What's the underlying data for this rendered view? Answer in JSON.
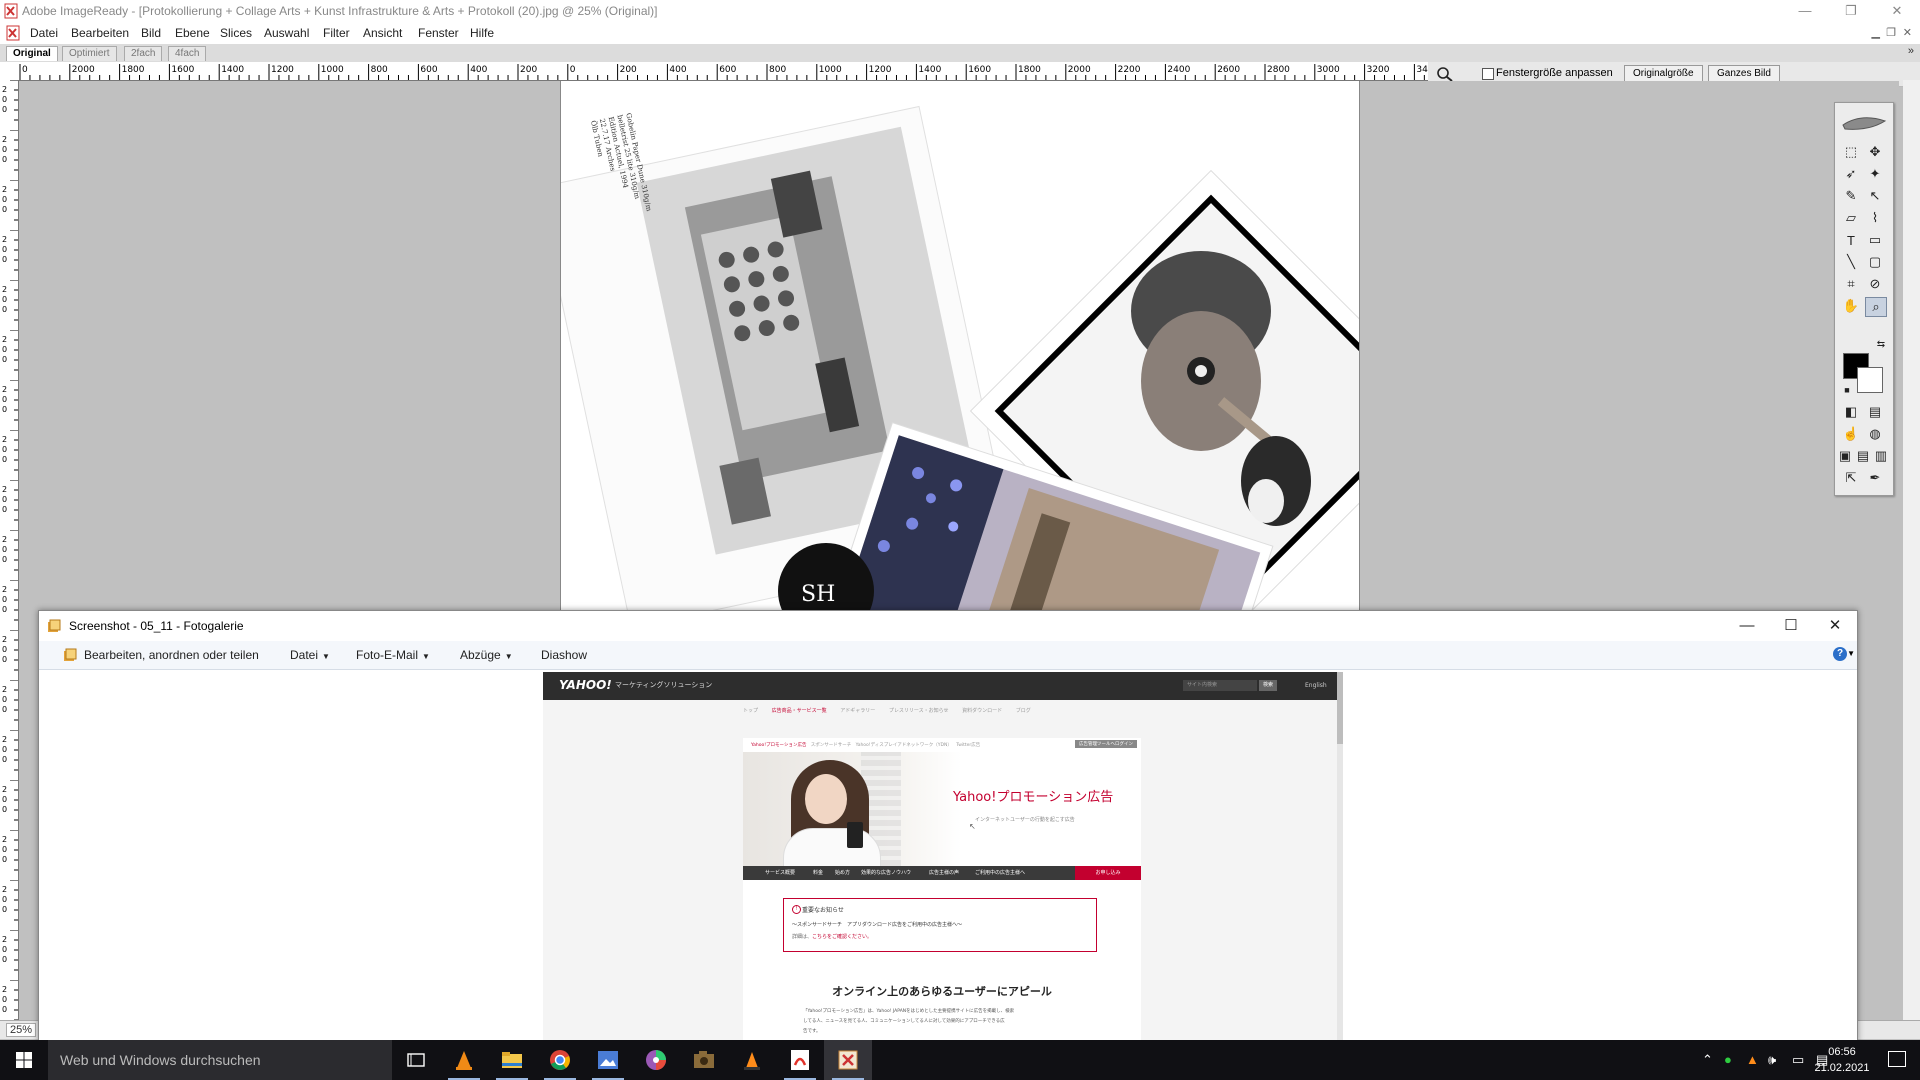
{
  "imageready": {
    "title": "Adobe ImageReady - [Protokollierung + Collage Arts + Kunst Infrastrukture & Arts + Protokoll (20).jpg @ 25% (Original)]",
    "window_controls": [
      "—",
      "❐",
      "✕"
    ],
    "menu": [
      "Datei",
      "Bearbeiten",
      "Bild",
      "Ebene",
      "Slices",
      "Auswahl",
      "Filter",
      "Ansicht",
      "Fenster",
      "Hilfe"
    ],
    "doc_tabs": [
      "Original",
      "Optimiert",
      "2fach",
      "4fach"
    ],
    "active_tab": "Original",
    "more_label": "»",
    "ruler_h_labels": [
      "0",
      "2000",
      "1800",
      "1600",
      "1400",
      "1200",
      "1000",
      "800",
      "600",
      "400",
      "200",
      "0",
      "200",
      "400",
      "600",
      "800",
      "1000",
      "1200",
      "1400",
      "1600",
      "1800",
      "2000",
      "2200",
      "2400",
      "2600",
      "2800",
      "3000",
      "3200",
      "340"
    ],
    "options": {
      "zoom_icon": "magnifier-icon",
      "fit_window_label": "Fenstergröße anpassen",
      "fit_window_checked": false,
      "actual_size_label": "Originalgröße",
      "whole_image_label": "Ganzes Bild"
    },
    "status": {
      "zoom": "25%"
    },
    "photo_caption": [
      "Ölb Tuben",
      "22.7.17 Arches",
      "Edition Actuel, 1994",
      "belletrist 25 lite 310g/m",
      "Gobelin Paper Dune 310g/m"
    ]
  },
  "photo_gallery": {
    "title": "Screenshot - 05_11 - Fotogalerie",
    "window_controls": [
      "—",
      "☐",
      "✕"
    ],
    "toolbar": {
      "edit": "Bearbeiten, anordnen oder teilen",
      "file": "Datei",
      "email": "Foto-E-Mail",
      "prints": "Abzüge",
      "slideshow": "Diashow",
      "help": "?"
    },
    "yahoo_page": {
      "logo": "YAHOO!",
      "logo_sub": "マーケティングソリューション",
      "search_placeholder": "サイト内検索",
      "search_btn": "検索",
      "english": "English",
      "nav": [
        "トップ",
        "広告商品・サービス一覧",
        "アドギャラリー",
        "プレスリリース・お知らせ",
        "資料ダウンロード",
        "ブログ"
      ],
      "subnav": [
        "Yahoo!プロモーション広告",
        "スポンサードサーチ",
        "Yahoo!ディスプレイアドネットワーク（YDN）",
        "Twitter広告"
      ],
      "login": "広告管理ツールへログイン",
      "hero_title": "Yahoo!プロモーション広告",
      "hero_sub": "インターネットユーザーの行動を起こす広告",
      "menu": [
        "サービス概要",
        "料金",
        "始め方",
        "効果的な広告ノウハウ",
        "広告主様の声",
        "ご利用中の広告主様へ"
      ],
      "apply": "お申し込み",
      "notice_title": "重要なお知らせ",
      "notice_line1": "～スポンサードサーチ　アプリダウンロード広告をご利用中の広告主様へ～",
      "notice_line2_prefix": "詳細は、",
      "notice_line2_link": "こちらをご確認ください。",
      "headline": "オンライン上のあらゆるユーザーにアピール",
      "body": [
        "「Yahoo!プロモーション広告」は、Yahoo! JAPANをはじめとした主要提携サイトに広告を掲載し、検索",
        "してる人、ニュースを見てる人、コミュニケーションしてる人に対して効果的にアプローチできる広",
        "告です。"
      ]
    }
  },
  "taskbar": {
    "search_placeholder": "Web und Windows durchsuchen",
    "time": "06:56",
    "date": "21.02.2021"
  },
  "colors": {
    "yahoo_red": "#c3002f",
    "taskbar": "#101014"
  }
}
